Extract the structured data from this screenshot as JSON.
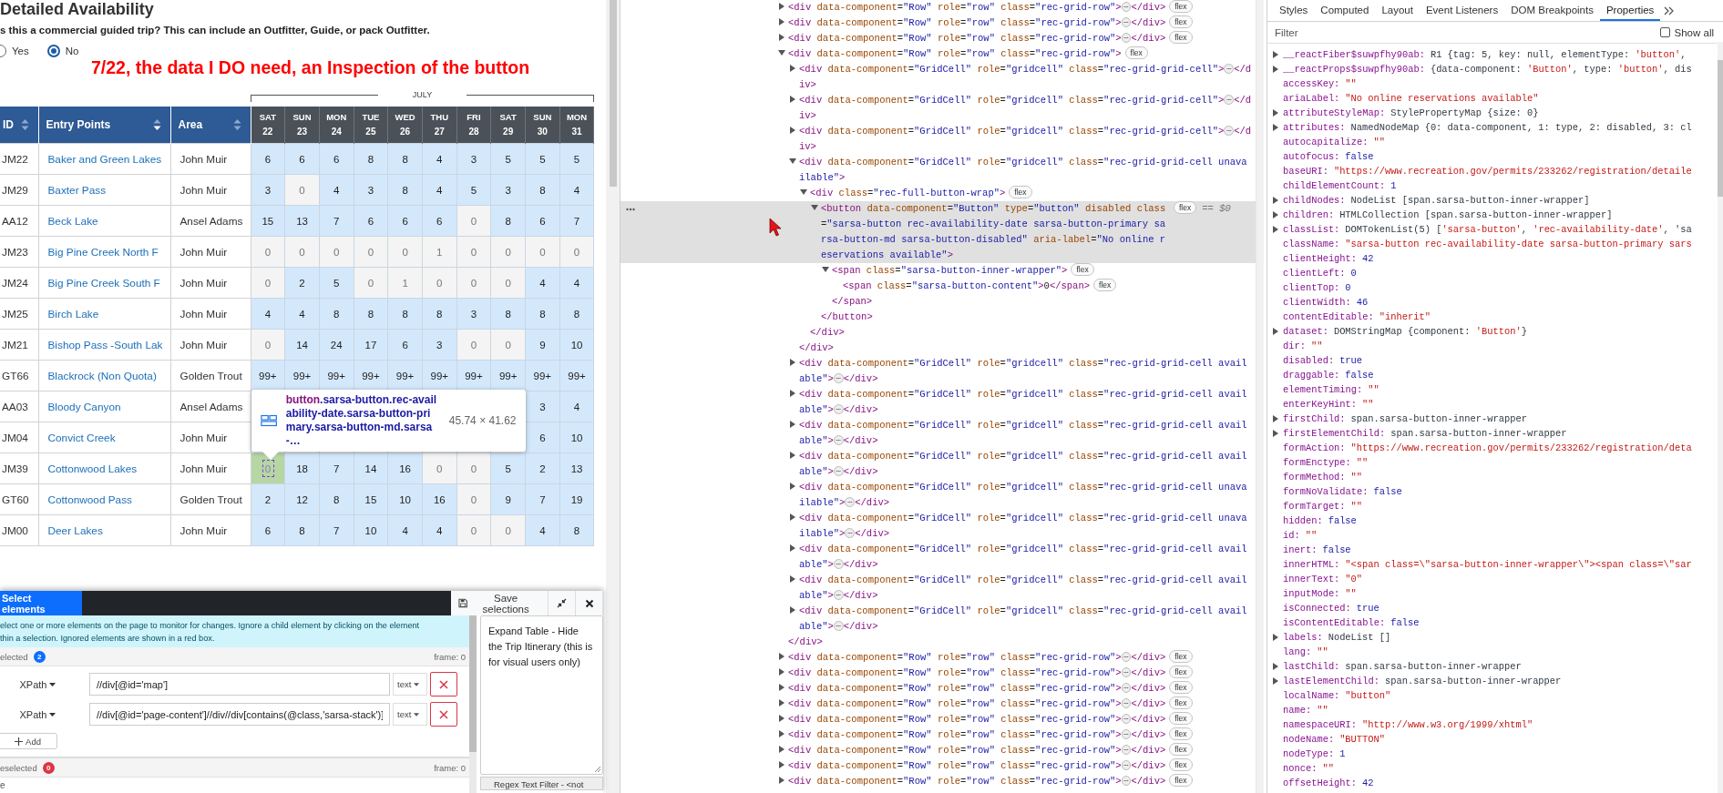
{
  "page": {
    "title": "Detailed Availability",
    "question": "s this a commercial guided trip? This can include an Outfitter, Guide, or pack Outfitter.",
    "options": [
      {
        "label": "Yes",
        "selected": false
      },
      {
        "label": "No",
        "selected": true
      }
    ],
    "annotation": "7/22, the data I DO need, an Inspection of the button",
    "month": "JULY",
    "columns": [
      {
        "label": "ID",
        "sorted": false
      },
      {
        "label": "Entry Points",
        "sorted": true
      },
      {
        "label": "Area",
        "sorted": false
      }
    ],
    "days": [
      {
        "weekday": "SAT",
        "date": "22"
      },
      {
        "weekday": "SUN",
        "date": "23"
      },
      {
        "weekday": "MON",
        "date": "24"
      },
      {
        "weekday": "TUE",
        "date": "25"
      },
      {
        "weekday": "WED",
        "date": "26"
      },
      {
        "weekday": "THU",
        "date": "27"
      },
      {
        "weekday": "FRI",
        "date": "28"
      },
      {
        "weekday": "SAT",
        "date": "29"
      },
      {
        "weekday": "SUN",
        "date": "30"
      },
      {
        "weekday": "MON",
        "date": "31"
      }
    ],
    "rows": [
      {
        "id": "JM22",
        "entry": "Baker and Green Lakes",
        "area": "John Muir",
        "cells": [
          {
            "count": "6",
            "available": true
          },
          {
            "count": "6",
            "available": true
          },
          {
            "count": "6",
            "available": true
          },
          {
            "count": "8",
            "available": true
          },
          {
            "count": "8",
            "available": true
          },
          {
            "count": "4",
            "available": true
          },
          {
            "count": "3",
            "available": true
          },
          {
            "count": "5",
            "available": true
          },
          {
            "count": "5",
            "available": true
          },
          {
            "count": "5",
            "available": true
          }
        ]
      },
      {
        "id": "JM29",
        "entry": "Baxter Pass",
        "area": "John Muir",
        "cells": [
          {
            "count": "3",
            "available": true
          },
          {
            "count": "0",
            "available": false
          },
          {
            "count": "4",
            "available": true
          },
          {
            "count": "3",
            "available": true
          },
          {
            "count": "8",
            "available": true
          },
          {
            "count": "4",
            "available": true
          },
          {
            "count": "5",
            "available": true
          },
          {
            "count": "3",
            "available": true
          },
          {
            "count": "8",
            "available": true
          },
          {
            "count": "4",
            "available": true
          }
        ]
      },
      {
        "id": "AA12",
        "entry": "Beck Lake",
        "area": "Ansel Adams",
        "cells": [
          {
            "count": "15",
            "available": true
          },
          {
            "count": "13",
            "available": true
          },
          {
            "count": "7",
            "available": true
          },
          {
            "count": "6",
            "available": true
          },
          {
            "count": "6",
            "available": true
          },
          {
            "count": "6",
            "available": true
          },
          {
            "count": "0",
            "available": false
          },
          {
            "count": "8",
            "available": true
          },
          {
            "count": "6",
            "available": true
          },
          {
            "count": "7",
            "available": true
          }
        ]
      },
      {
        "id": "JM23",
        "entry": "Big Pine Creek North F",
        "area": "John Muir",
        "cells": [
          {
            "count": "0",
            "available": false
          },
          {
            "count": "0",
            "available": false
          },
          {
            "count": "0",
            "available": false
          },
          {
            "count": "0",
            "available": false
          },
          {
            "count": "0",
            "available": false
          },
          {
            "count": "1",
            "available": false
          },
          {
            "count": "0",
            "available": false
          },
          {
            "count": "0",
            "available": false
          },
          {
            "count": "0",
            "available": false
          },
          {
            "count": "0",
            "available": false
          }
        ]
      },
      {
        "id": "JM24",
        "entry": "Big Pine Creek South F",
        "area": "John Muir",
        "cells": [
          {
            "count": "0",
            "available": false
          },
          {
            "count": "2",
            "available": true
          },
          {
            "count": "5",
            "available": true
          },
          {
            "count": "0",
            "available": false
          },
          {
            "count": "1",
            "available": false
          },
          {
            "count": "0",
            "available": false
          },
          {
            "count": "0",
            "available": false
          },
          {
            "count": "0",
            "available": false
          },
          {
            "count": "4",
            "available": true
          },
          {
            "count": "4",
            "available": true
          }
        ]
      },
      {
        "id": "JM25",
        "entry": "Birch Lake",
        "area": "John Muir",
        "cells": [
          {
            "count": "4",
            "available": true
          },
          {
            "count": "4",
            "available": true
          },
          {
            "count": "8",
            "available": true
          },
          {
            "count": "8",
            "available": true
          },
          {
            "count": "8",
            "available": true
          },
          {
            "count": "8",
            "available": true
          },
          {
            "count": "3",
            "available": true
          },
          {
            "count": "8",
            "available": true
          },
          {
            "count": "8",
            "available": true
          },
          {
            "count": "8",
            "available": true
          }
        ]
      },
      {
        "id": "JM21",
        "entry": "Bishop Pass -South Lak",
        "area": "John Muir",
        "cells": [
          {
            "count": "0",
            "available": false
          },
          {
            "count": "14",
            "available": true
          },
          {
            "count": "24",
            "available": true
          },
          {
            "count": "17",
            "available": true
          },
          {
            "count": "6",
            "available": true
          },
          {
            "count": "3",
            "available": true
          },
          {
            "count": "0",
            "available": false
          },
          {
            "count": "0",
            "available": false
          },
          {
            "count": "9",
            "available": true
          },
          {
            "count": "10",
            "available": true
          }
        ]
      },
      {
        "id": "GT66",
        "entry": "Blackrock (Non Quota)",
        "area": "Golden Trout",
        "cells": [
          {
            "count": "99+",
            "available": true
          },
          {
            "count": "99+",
            "available": true
          },
          {
            "count": "99+",
            "available": true
          },
          {
            "count": "99+",
            "available": true
          },
          {
            "count": "99+",
            "available": true
          },
          {
            "count": "99+",
            "available": true
          },
          {
            "count": "99+",
            "available": true
          },
          {
            "count": "99+",
            "available": true
          },
          {
            "count": "99+",
            "available": true
          },
          {
            "count": "99+",
            "available": true
          }
        ]
      },
      {
        "id": "AA03",
        "entry": "Bloody Canyon",
        "area": "Ansel Adams",
        "cells": [
          null,
          null,
          null,
          null,
          null,
          null,
          null,
          null,
          {
            "count": "3",
            "available": true
          },
          {
            "count": "4",
            "available": true
          }
        ]
      },
      {
        "id": "JM04",
        "entry": "Convict Creek",
        "area": "John Muir",
        "cells": [
          null,
          null,
          null,
          null,
          null,
          null,
          null,
          null,
          {
            "count": "6",
            "available": true
          },
          {
            "count": "10",
            "available": true
          }
        ]
      },
      {
        "id": "JM39",
        "entry": "Cottonwood Lakes",
        "area": "John Muir",
        "cells": [
          {
            "count": "0",
            "available": false,
            "inspected": true
          },
          {
            "count": "18",
            "available": true
          },
          {
            "count": "7",
            "available": true
          },
          {
            "count": "14",
            "available": true
          },
          {
            "count": "16",
            "available": true
          },
          {
            "count": "0",
            "available": false
          },
          {
            "count": "0",
            "available": false
          },
          {
            "count": "5",
            "available": true
          },
          {
            "count": "2",
            "available": true
          },
          {
            "count": "13",
            "available": true
          }
        ]
      },
      {
        "id": "GT60",
        "entry": "Cottonwood Pass",
        "area": "Golden Trout",
        "cells": [
          {
            "count": "2",
            "available": true
          },
          {
            "count": "12",
            "available": true
          },
          {
            "count": "8",
            "available": true
          },
          {
            "count": "15",
            "available": true
          },
          {
            "count": "10",
            "available": true
          },
          {
            "count": "16",
            "available": true
          },
          {
            "count": "0",
            "available": false
          },
          {
            "count": "9",
            "available": true
          },
          {
            "count": "7",
            "available": true
          },
          {
            "count": "19",
            "available": true
          }
        ]
      },
      {
        "id": "JM00",
        "entry": "Deer Lakes",
        "area": "John Muir",
        "cells": [
          {
            "count": "6",
            "available": true
          },
          {
            "count": "8",
            "available": true
          },
          {
            "count": "7",
            "available": true
          },
          {
            "count": "10",
            "available": true
          },
          {
            "count": "4",
            "available": true
          },
          {
            "count": "4",
            "available": true
          },
          {
            "count": "0",
            "available": false
          },
          {
            "count": "0",
            "available": false
          },
          {
            "count": "4",
            "available": true
          },
          {
            "count": "8",
            "available": true
          }
        ]
      }
    ],
    "tooltip": {
      "tag": "button",
      "classes": ".sarsa-button.rec-availability-date.sarsa-button-primary.sarsa-button-md.sarsa-…",
      "size": "45.74 × 41.62"
    }
  },
  "picker": {
    "tab": "Select elements",
    "save": "Save selections",
    "info_lines": [
      "elect one or more elements on the page to monitor for changes. Ignore a child element by clicking on the element",
      "thin a selection. Ignored elements are shown in a red box."
    ],
    "selected": {
      "label": "elected",
      "count": "2",
      "frame": "frame: 0"
    },
    "selectors": [
      {
        "type": "XPath",
        "value": "//div[@id='map']",
        "mode": "text"
      },
      {
        "type": "XPath",
        "value": "//div[@id='page-content']//div//div[contains(@class,'sarsa-stack')]",
        "mode": "text"
      }
    ],
    "add": "Add",
    "deselected": {
      "label": "eselected",
      "count": "0",
      "frame": "frame: 0"
    },
    "deselected_item": "e",
    "notes": "Expand Table - Hide the Trip Itinerary (this is for visual users only)",
    "regex_label": "Regex Text Filter - <not"
  },
  "elements": {
    "nodes": [
      {
        "text": "<div data-component=\"Row\" role=\"row\" class=\"rec-grid-row\">⋯</div>",
        "badge": "flex",
        "expanded": false,
        "selected": false
      },
      {
        "text": "<div data-component=\"Row\" role=\"row\" class=\"rec-grid-row\">⋯</div>",
        "badge": "flex",
        "expanded": false,
        "selected": false
      },
      {
        "text": "<div data-component=\"Row\" role=\"row\" class=\"rec-grid-row\">⋯</div>",
        "badge": "flex",
        "expanded": false,
        "selected": false
      },
      {
        "text": "<div data-component=\"Row\" role=\"row\" class=\"rec-grid-row\">",
        "badge": "flex",
        "expanded": true,
        "selected": false,
        "close": "</div>",
        "children": [
          {
            "text": "<div data-component=\"GridCell\" role=\"gridcell\" class=\"rec-grid-grid-cell\">⋯</div>",
            "expanded": false,
            "selected": false
          },
          {
            "text": "<div data-component=\"GridCell\" role=\"gridcell\" class=\"rec-grid-grid-cell\">⋯</div>",
            "expanded": false,
            "selected": false
          },
          {
            "text": "<div data-component=\"GridCell\" role=\"gridcell\" class=\"rec-grid-grid-cell\">⋯</div>",
            "expanded": false,
            "selected": false
          },
          {
            "text": "<div data-component=\"GridCell\" role=\"gridcell\" class=\"rec-grid-grid-cell unavailable\">",
            "expanded": true,
            "selected": false,
            "close": "</div>",
            "children": [
              {
                "text": "<div class=\"rec-full-button-wrap\">",
                "badge": "flex",
                "expanded": true,
                "selected": false,
                "close": "</div>",
                "children": [
                  {
                    "text": "<button data-component=\"Button\" type=\"button\" disabled class=\"sarsa-button rec-availability-date sarsa-button-primary sarsa-button-md sarsa-button-disabled\" aria-label=\"No online reservations available\">",
                    "badge": "flex",
                    "suffix": "== $0",
                    "expanded": true,
                    "selected": true,
                    "close": "</button>",
                    "children": [
                      {
                        "text": "<span class=\"sarsa-button-inner-wrapper\">",
                        "badge": "flex",
                        "expanded": true,
                        "selected": false,
                        "close": "</span>",
                        "children": [
                          {
                            "text": "<span class=\"sarsa-button-content\">0</span>",
                            "badge": "flex",
                            "selected": false
                          }
                        ]
                      }
                    ]
                  }
                ]
              }
            ]
          },
          {
            "text": "<div data-component=\"GridCell\" role=\"gridcell\" class=\"rec-grid-grid-cell available\">⋯</div>",
            "expanded": false,
            "selected": false
          },
          {
            "text": "<div data-component=\"GridCell\" role=\"gridcell\" class=\"rec-grid-grid-cell available\">⋯</div>",
            "expanded": false,
            "selected": false
          },
          {
            "text": "<div data-component=\"GridCell\" role=\"gridcell\" class=\"rec-grid-grid-cell available\">⋯</div>",
            "expanded": false,
            "selected": false
          },
          {
            "text": "<div data-component=\"GridCell\" role=\"gridcell\" class=\"rec-grid-grid-cell available\">⋯</div>",
            "expanded": false,
            "selected": false
          },
          {
            "text": "<div data-component=\"GridCell\" role=\"gridcell\" class=\"rec-grid-grid-cell unavailable\">⋯</div>",
            "expanded": false,
            "selected": false
          },
          {
            "text": "<div data-component=\"GridCell\" role=\"gridcell\" class=\"rec-grid-grid-cell unavailable\">⋯</div>",
            "expanded": false,
            "selected": false
          },
          {
            "text": "<div data-component=\"GridCell\" role=\"gridcell\" class=\"rec-grid-grid-cell available\">⋯</div>",
            "expanded": false,
            "selected": false
          },
          {
            "text": "<div data-component=\"GridCell\" role=\"gridcell\" class=\"rec-grid-grid-cell available\">⋯</div>",
            "expanded": false,
            "selected": false
          },
          {
            "text": "<div data-component=\"GridCell\" role=\"gridcell\" class=\"rec-grid-grid-cell available\">⋯</div>",
            "expanded": false,
            "selected": false
          }
        ]
      },
      {
        "text": "<div data-component=\"Row\" role=\"row\" class=\"rec-grid-row\">⋯</div>",
        "badge": "flex",
        "expanded": false,
        "selected": false
      },
      {
        "text": "<div data-component=\"Row\" role=\"row\" class=\"rec-grid-row\">⋯</div>",
        "badge": "flex",
        "expanded": false,
        "selected": false
      },
      {
        "text": "<div data-component=\"Row\" role=\"row\" class=\"rec-grid-row\">⋯</div>",
        "badge": "flex",
        "expanded": false,
        "selected": false
      },
      {
        "text": "<div data-component=\"Row\" role=\"row\" class=\"rec-grid-row\">⋯</div>",
        "badge": "flex",
        "expanded": false,
        "selected": false
      },
      {
        "text": "<div data-component=\"Row\" role=\"row\" class=\"rec-grid-row\">⋯</div>",
        "badge": "flex",
        "expanded": false,
        "selected": false
      },
      {
        "text": "<div data-component=\"Row\" role=\"row\" class=\"rec-grid-row\">⋯</div>",
        "badge": "flex",
        "expanded": false,
        "selected": false
      },
      {
        "text": "<div data-component=\"Row\" role=\"row\" class=\"rec-grid-row\">⋯</div>",
        "badge": "flex",
        "expanded": false,
        "selected": false
      },
      {
        "text": "<div data-component=\"Row\" role=\"row\" class=\"rec-grid-row\">⋯</div>",
        "badge": "flex",
        "expanded": false,
        "selected": false
      },
      {
        "text": "<div data-component=\"Row\" role=\"row\" class=\"rec-grid-row\">⋯</div>",
        "badge": "flex",
        "expanded": false,
        "selected": false
      }
    ]
  },
  "properties": {
    "tabs": [
      {
        "label": "Styles",
        "selected": false
      },
      {
        "label": "Computed",
        "selected": false
      },
      {
        "label": "Layout",
        "selected": false
      },
      {
        "label": "Event Listeners",
        "selected": false
      },
      {
        "label": "DOM Breakpoints",
        "selected": false
      },
      {
        "label": "Properties",
        "selected": true
      }
    ],
    "filter_placeholder": "Filter",
    "show_all": {
      "label": "Show all",
      "checked": false
    },
    "items": [
      {
        "name": "__reactFiber$suwpfhy90ab:",
        "value": "R1 {tag: 5, key: null, elementType: 'button',",
        "kind": "object",
        "expandable": true
      },
      {
        "name": "__reactProps$suwpfhy90ab:",
        "value": "{data-component: 'Button', type: 'button', dis",
        "kind": "object",
        "expandable": true
      },
      {
        "name": "accessKey:",
        "value": "\"\"",
        "kind": "string",
        "expandable": false
      },
      {
        "name": "ariaLabel:",
        "value": "\"No online reservations available\"",
        "kind": "string",
        "expandable": false
      },
      {
        "name": "attributeStyleMap:",
        "value": "StylePropertyMap {size: 0}",
        "kind": "object",
        "expandable": true
      },
      {
        "name": "attributes:",
        "value": "NamedNodeMap {0: data-component, 1: type, 2: disabled, 3: cl",
        "kind": "object",
        "expandable": true
      },
      {
        "name": "autocapitalize:",
        "value": "\"\"",
        "kind": "string",
        "expandable": false
      },
      {
        "name": "autofocus:",
        "value": "false",
        "kind": "literal",
        "expandable": false
      },
      {
        "name": "baseURI:",
        "value": "\"https://www.recreation.gov/permits/233262/registration/detaile",
        "kind": "string",
        "expandable": false
      },
      {
        "name": "childElementCount:",
        "value": "1",
        "kind": "literal",
        "expandable": false
      },
      {
        "name": "childNodes:",
        "value": "NodeList [span.sarsa-button-inner-wrapper]",
        "kind": "object",
        "expandable": true
      },
      {
        "name": "children:",
        "value": "HTMLCollection [span.sarsa-button-inner-wrapper]",
        "kind": "object",
        "expandable": true
      },
      {
        "name": "classList:",
        "value": "DOMTokenList(5) ['sarsa-button', 'rec-availability-date', 'sa",
        "kind": "object",
        "expandable": true
      },
      {
        "name": "className:",
        "value": "\"sarsa-button rec-availability-date sarsa-button-primary sars",
        "kind": "string",
        "expandable": false
      },
      {
        "name": "clientHeight:",
        "value": "42",
        "kind": "literal",
        "expandable": false
      },
      {
        "name": "clientLeft:",
        "value": "0",
        "kind": "literal",
        "expandable": false
      },
      {
        "name": "clientTop:",
        "value": "0",
        "kind": "literal",
        "expandable": false
      },
      {
        "name": "clientWidth:",
        "value": "46",
        "kind": "literal",
        "expandable": false
      },
      {
        "name": "contentEditable:",
        "value": "\"inherit\"",
        "kind": "string",
        "expandable": false
      },
      {
        "name": "dataset:",
        "value": "DOMStringMap {component: 'Button'}",
        "kind": "object",
        "expandable": true
      },
      {
        "name": "dir:",
        "value": "\"\"",
        "kind": "string",
        "expandable": false
      },
      {
        "name": "disabled:",
        "value": "true",
        "kind": "literal",
        "expandable": false
      },
      {
        "name": "draggable:",
        "value": "false",
        "kind": "literal",
        "expandable": false
      },
      {
        "name": "elementTiming:",
        "value": "\"\"",
        "kind": "string",
        "expandable": false
      },
      {
        "name": "enterKeyHint:",
        "value": "\"\"",
        "kind": "string",
        "expandable": false
      },
      {
        "name": "firstChild:",
        "value": "span.sarsa-button-inner-wrapper",
        "kind": "object",
        "expandable": true
      },
      {
        "name": "firstElementChild:",
        "value": "span.sarsa-button-inner-wrapper",
        "kind": "object",
        "expandable": true
      },
      {
        "name": "formAction:",
        "value": "\"https://www.recreation.gov/permits/233262/registration/deta",
        "kind": "string",
        "expandable": false
      },
      {
        "name": "formEnctype:",
        "value": "\"\"",
        "kind": "string",
        "expandable": false
      },
      {
        "name": "formMethod:",
        "value": "\"\"",
        "kind": "string",
        "expandable": false
      },
      {
        "name": "formNoValidate:",
        "value": "false",
        "kind": "literal",
        "expandable": false
      },
      {
        "name": "formTarget:",
        "value": "\"\"",
        "kind": "string",
        "expandable": false
      },
      {
        "name": "hidden:",
        "value": "false",
        "kind": "literal",
        "expandable": false
      },
      {
        "name": "id:",
        "value": "\"\"",
        "kind": "string",
        "expandable": false
      },
      {
        "name": "inert:",
        "value": "false",
        "kind": "literal",
        "expandable": false
      },
      {
        "name": "innerHTML:",
        "value": "\"<span class=\\\"sarsa-button-inner-wrapper\\\"><span class=\\\"sar",
        "kind": "string",
        "expandable": false
      },
      {
        "name": "innerText:",
        "value": "\"0\"",
        "kind": "string",
        "expandable": false
      },
      {
        "name": "inputMode:",
        "value": "\"\"",
        "kind": "string",
        "expandable": false
      },
      {
        "name": "isConnected:",
        "value": "true",
        "kind": "literal",
        "expandable": false
      },
      {
        "name": "isContentEditable:",
        "value": "false",
        "kind": "literal",
        "expandable": false
      },
      {
        "name": "labels:",
        "value": "NodeList []",
        "kind": "object",
        "expandable": true
      },
      {
        "name": "lang:",
        "value": "\"\"",
        "kind": "string",
        "expandable": false
      },
      {
        "name": "lastChild:",
        "value": "span.sarsa-button-inner-wrapper",
        "kind": "object",
        "expandable": true
      },
      {
        "name": "lastElementChild:",
        "value": "span.sarsa-button-inner-wrapper",
        "kind": "object",
        "expandable": true
      },
      {
        "name": "localName:",
        "value": "\"button\"",
        "kind": "string",
        "expandable": false
      },
      {
        "name": "name:",
        "value": "\"\"",
        "kind": "string",
        "expandable": false
      },
      {
        "name": "namespaceURI:",
        "value": "\"http://www.w3.org/1999/xhtml\"",
        "kind": "string",
        "expandable": false
      },
      {
        "name": "nodeName:",
        "value": "\"BUTTON\"",
        "kind": "string",
        "expandable": false
      },
      {
        "name": "nodeType:",
        "value": "1",
        "kind": "literal",
        "expandable": false
      },
      {
        "name": "nonce:",
        "value": "\"\"",
        "kind": "string",
        "expandable": false
      },
      {
        "name": "offsetHeight:",
        "value": "42",
        "kind": "literal",
        "expandable": false
      }
    ]
  }
}
